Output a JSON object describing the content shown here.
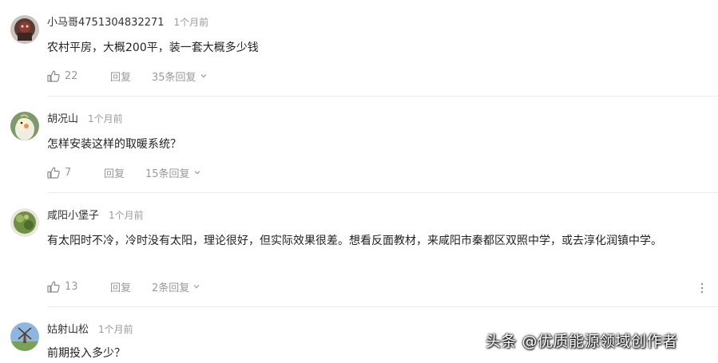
{
  "comments": [
    {
      "username": "小马哥4751304832271",
      "time": "1个月前",
      "content": "农村平房，大概200平，装一套大概多少钱",
      "likes": "22",
      "reply_label": "回复",
      "replies_label": "35条回复",
      "avatar_icon": "avatar-dark-figure-icon"
    },
    {
      "username": "胡况山",
      "time": "1个月前",
      "content": "怎样安装这样的取暖系统？",
      "likes": "7",
      "reply_label": "回复",
      "replies_label": "15条回复",
      "avatar_icon": "avatar-cockatiel-icon"
    },
    {
      "username": "咸阳小堡子",
      "time": "1个月前",
      "content": "有太阳时不冷，冷时没有太阳，理论很好，但实际效果很差。想看反面教材，来咸阳市秦都区双照中学，或去淳化润镇中学。",
      "likes": "13",
      "reply_label": "回复",
      "replies_label": "2条回复",
      "avatar_icon": "avatar-plant-icon"
    },
    {
      "username": "姑射山松",
      "time": "1个月前",
      "content": "前期投入多少？",
      "avatar_icon": "avatar-windmill-icon"
    }
  ],
  "watermark": "头条 @优质能源领域创作者",
  "colors": {
    "text": "#222222",
    "muted": "#999999",
    "divider": "#ececec"
  }
}
